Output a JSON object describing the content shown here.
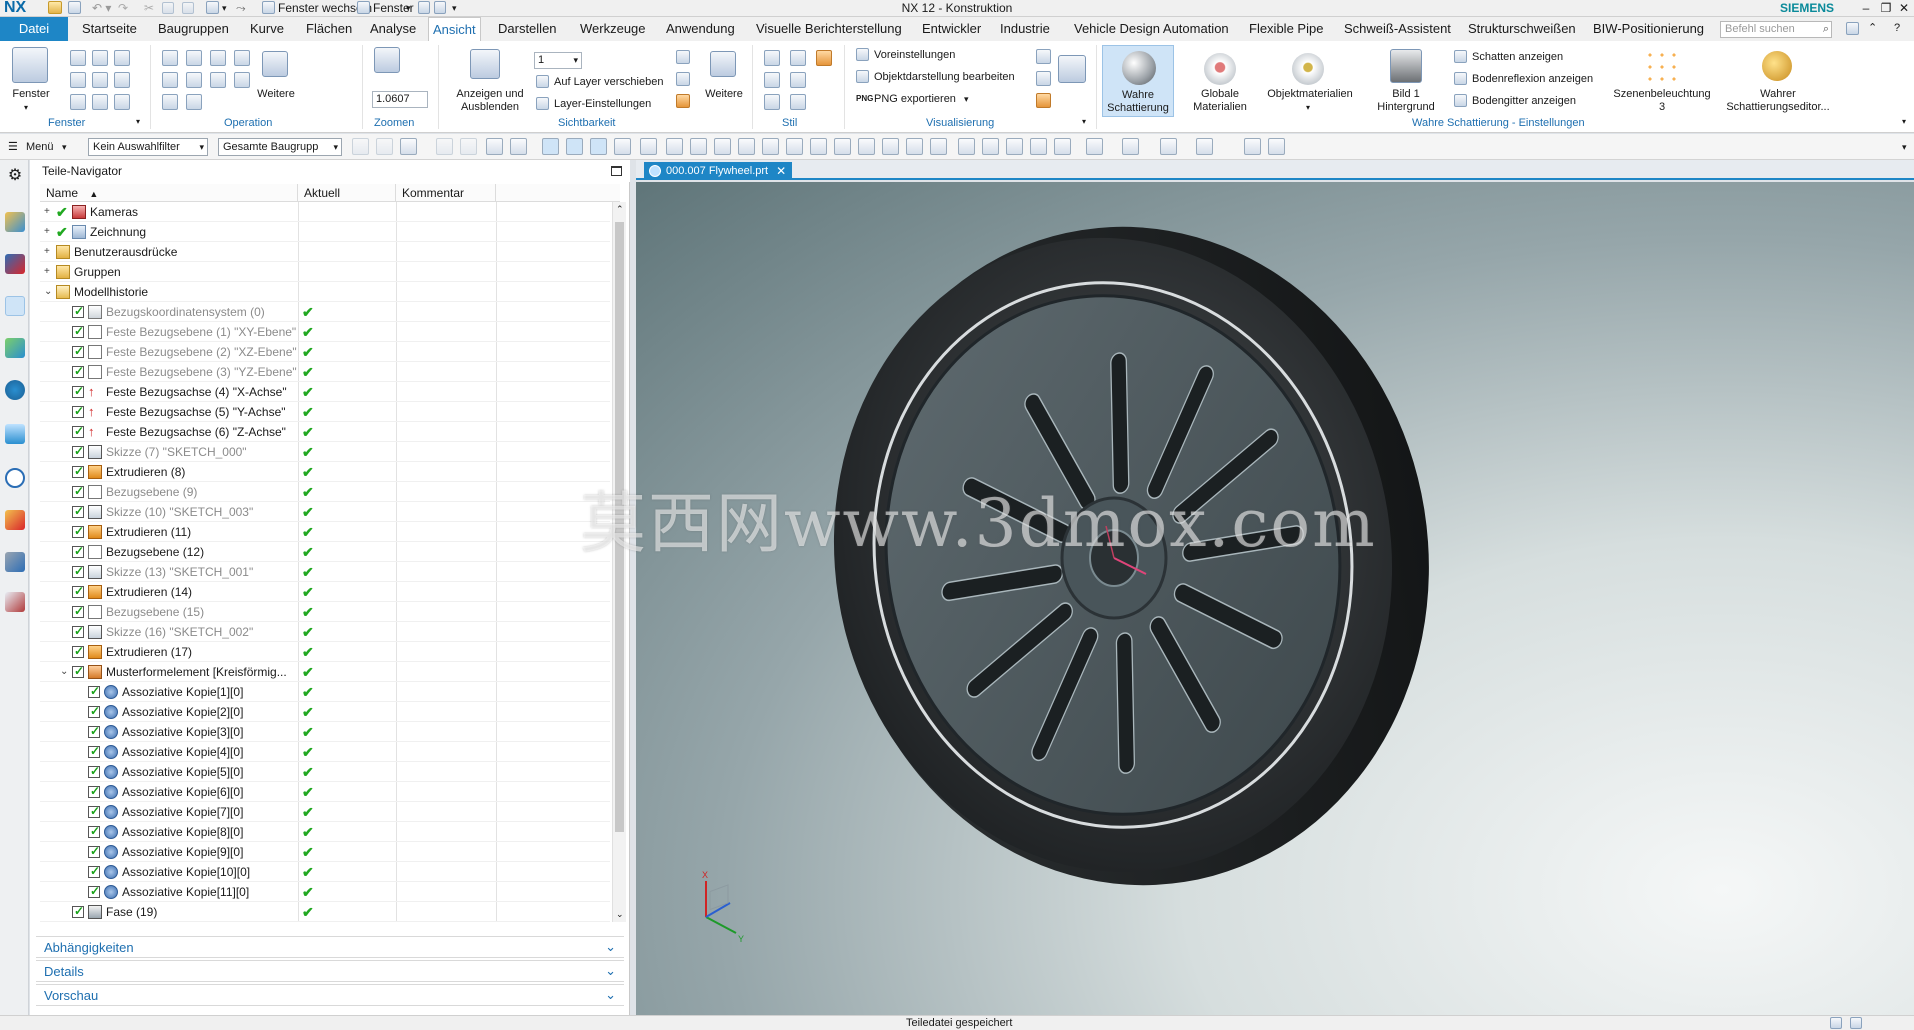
{
  "app": {
    "logo": "NX",
    "title": "NX 12 - Konstruktion",
    "brand": "SIEMENS",
    "quick_access": {
      "switch_window": "Fenster wechseln",
      "window": "Fenster"
    },
    "window_controls": [
      "–",
      "❐",
      "✕"
    ]
  },
  "menu": {
    "file_tab": "Datei",
    "tabs": [
      "Startseite",
      "Baugruppen",
      "Kurve",
      "Flächen",
      "Analyse",
      "Ansicht",
      "Darstellen",
      "Werkzeuge",
      "Anwendung",
      "Visuelle Berichterstellung",
      "Entwickler",
      "Industrie",
      "Vehicle Design Automation",
      "Flexible Pipe",
      "Schweiß-Assistent",
      "Strukturschweißen",
      "BIW-Positionierung"
    ],
    "active_tab": "Ansicht",
    "command_search_placeholder": "Befehl suchen"
  },
  "ribbon": {
    "groups": {
      "fenster": "Fenster",
      "operation": "Operation",
      "zoomen": "Zoomen",
      "sichtbarkeit": "Sichtbarkeit",
      "stil": "Stil",
      "visualisierung": "Visualisierung",
      "schattierung_einstellungen": "Wahre Schattierung - Einstellungen"
    },
    "fenster_button": "Fenster",
    "weitere": "Weitere",
    "zoom_value": "1.0607",
    "anzeigen_ausblenden": "Anzeigen und\nAusblenden",
    "layer_value": "1",
    "auf_layer_verschieben": "Auf Layer verschieben",
    "layer_einstellungen": "Layer-Einstellungen",
    "voreinstellungen": "Voreinstellungen",
    "objektdarstellung": "Objektdarstellung bearbeiten",
    "png_exportieren": "PNG exportieren",
    "wahre_schattierung": "Wahre\nSchattierung",
    "globale_materialien": "Globale\nMaterialien",
    "objektmaterialien": "Objektmaterialien",
    "bild_hintergrund": "Bild 1\nHintergrund",
    "schatten_anzeigen": "Schatten anzeigen",
    "bodenreflexion": "Bodenreflexion anzeigen",
    "bodengitter": "Bodengitter anzeigen",
    "szenenbeleuchtung": "Szenenbeleuchtung\n3",
    "schattierungseditor": "Wahrer\nSchattierungseditor..."
  },
  "toolbar": {
    "menu_label": "Menü",
    "selection_filter": "Kein Auswahlfilter",
    "scope": "Gesamte Baugrupp"
  },
  "navigator": {
    "title": "Teile-Navigator",
    "columns": [
      "Name",
      "Aktuell",
      "Kommentar"
    ],
    "rows": [
      {
        "name": "Kameras",
        "level": 0,
        "dim": false,
        "icon": "camera-icon",
        "status": false
      },
      {
        "name": "Zeichnung",
        "level": 0,
        "dim": false,
        "icon": "drawing-icon",
        "status": false
      },
      {
        "name": "Benutzerausdrücke",
        "level": 0,
        "dim": false,
        "icon": "folder-icon",
        "status": false
      },
      {
        "name": "Gruppen",
        "level": 0,
        "dim": false,
        "icon": "folder-icon",
        "status": false
      },
      {
        "name": "Modellhistorie",
        "level": 0,
        "dim": false,
        "icon": "folder-open-icon",
        "status": false
      },
      {
        "name": "Bezugskoordinatensystem (0)",
        "level": 1,
        "dim": true,
        "icon": "csys-icon",
        "status": true
      },
      {
        "name": "Feste Bezugsebene (1) \"XY-Ebene\"",
        "level": 1,
        "dim": true,
        "icon": "plane-icon",
        "status": true
      },
      {
        "name": "Feste Bezugsebene (2) \"XZ-Ebene\"",
        "level": 1,
        "dim": true,
        "icon": "plane-icon",
        "status": true
      },
      {
        "name": "Feste Bezugsebene (3) \"YZ-Ebene\"",
        "level": 1,
        "dim": true,
        "icon": "plane-icon",
        "status": true
      },
      {
        "name": "Feste Bezugsachse (4) \"X-Achse\"",
        "level": 1,
        "dim": false,
        "icon": "axis-icon",
        "status": true
      },
      {
        "name": "Feste Bezugsachse (5) \"Y-Achse\"",
        "level": 1,
        "dim": false,
        "icon": "axis-icon",
        "status": true
      },
      {
        "name": "Feste Bezugsachse (6) \"Z-Achse\"",
        "level": 1,
        "dim": false,
        "icon": "axis-icon",
        "status": true
      },
      {
        "name": "Skizze (7) \"SKETCH_000\"",
        "level": 1,
        "dim": true,
        "icon": "sketch-icon",
        "status": true
      },
      {
        "name": "Extrudieren (8)",
        "level": 1,
        "dim": false,
        "icon": "extrude-icon",
        "status": true
      },
      {
        "name": "Bezugsebene (9)",
        "level": 1,
        "dim": true,
        "icon": "plane-icon",
        "status": true
      },
      {
        "name": "Skizze (10) \"SKETCH_003\"",
        "level": 1,
        "dim": true,
        "icon": "sketch-icon",
        "status": true
      },
      {
        "name": "Extrudieren (11)",
        "level": 1,
        "dim": false,
        "icon": "extrude-icon",
        "status": true
      },
      {
        "name": "Bezugsebene (12)",
        "level": 1,
        "dim": false,
        "icon": "plane-icon",
        "status": true
      },
      {
        "name": "Skizze (13) \"SKETCH_001\"",
        "level": 1,
        "dim": true,
        "icon": "sketch-icon",
        "status": true
      },
      {
        "name": "Extrudieren (14)",
        "level": 1,
        "dim": false,
        "icon": "extrude-icon",
        "status": true
      },
      {
        "name": "Bezugsebene (15)",
        "level": 1,
        "dim": true,
        "icon": "plane-icon",
        "status": true
      },
      {
        "name": "Skizze (16) \"SKETCH_002\"",
        "level": 1,
        "dim": true,
        "icon": "sketch-icon",
        "status": true
      },
      {
        "name": "Extrudieren (17)",
        "level": 1,
        "dim": false,
        "icon": "extrude-icon",
        "status": true
      },
      {
        "name": "Musterformelement [Kreisförmig...",
        "level": 1,
        "dim": false,
        "icon": "pattern-icon",
        "status": true
      },
      {
        "name": "Assoziative Kopie[1][0]",
        "level": 2,
        "dim": false,
        "icon": "copy-icon",
        "status": true
      },
      {
        "name": "Assoziative Kopie[2][0]",
        "level": 2,
        "dim": false,
        "icon": "copy-icon",
        "status": true
      },
      {
        "name": "Assoziative Kopie[3][0]",
        "level": 2,
        "dim": false,
        "icon": "copy-icon",
        "status": true
      },
      {
        "name": "Assoziative Kopie[4][0]",
        "level": 2,
        "dim": false,
        "icon": "copy-icon",
        "status": true
      },
      {
        "name": "Assoziative Kopie[5][0]",
        "level": 2,
        "dim": false,
        "icon": "copy-icon",
        "status": true
      },
      {
        "name": "Assoziative Kopie[6][0]",
        "level": 2,
        "dim": false,
        "icon": "copy-icon",
        "status": true
      },
      {
        "name": "Assoziative Kopie[7][0]",
        "level": 2,
        "dim": false,
        "icon": "copy-icon",
        "status": true
      },
      {
        "name": "Assoziative Kopie[8][0]",
        "level": 2,
        "dim": false,
        "icon": "copy-icon",
        "status": true
      },
      {
        "name": "Assoziative Kopie[9][0]",
        "level": 2,
        "dim": false,
        "icon": "copy-icon",
        "status": true
      },
      {
        "name": "Assoziative Kopie[10][0]",
        "level": 2,
        "dim": false,
        "icon": "copy-icon",
        "status": true
      },
      {
        "name": "Assoziative Kopie[11][0]",
        "level": 2,
        "dim": false,
        "icon": "copy-icon",
        "status": true
      },
      {
        "name": "Fase (19)",
        "level": 1,
        "dim": false,
        "icon": "chamfer-icon",
        "status": true
      }
    ],
    "panels": [
      "Abhängigkeiten",
      "Details",
      "Vorschau"
    ]
  },
  "viewport": {
    "doc_tab": "000.007 Flywheel.prt",
    "watermark": "莫西网www.3dmox.com",
    "triad": {
      "x": "X",
      "y": "Y"
    }
  },
  "status": {
    "message": "Teiledatei gespeichert"
  },
  "colors": {
    "accent": "#1e86c6",
    "check": "#21a821"
  }
}
